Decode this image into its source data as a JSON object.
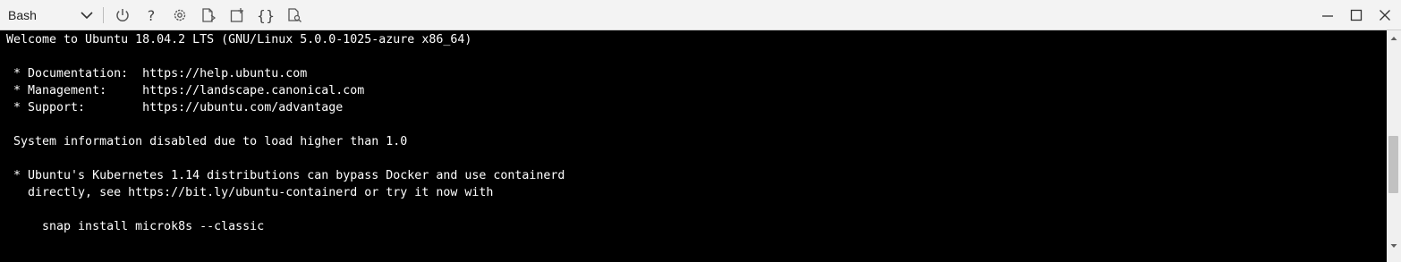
{
  "toolbar": {
    "shell_label": "Bash",
    "help_glyph": "?",
    "braces_glyph": "{}",
    "icons": [
      "restart-icon",
      "help-icon",
      "settings-icon",
      "upload-download-icon",
      "new-session-icon",
      "editor-icon",
      "web-preview-icon"
    ]
  },
  "window": {
    "controls": [
      "minimize-icon",
      "maximize-icon",
      "close-icon"
    ]
  },
  "terminal": {
    "lines": [
      "Welcome to Ubuntu 18.04.2 LTS (GNU/Linux 5.0.0-1025-azure x86_64)",
      "",
      " * Documentation:  https://help.ubuntu.com",
      " * Management:     https://landscape.canonical.com",
      " * Support:        https://ubuntu.com/advantage",
      "",
      " System information disabled due to load higher than 1.0",
      "",
      " * Ubuntu's Kubernetes 1.14 distributions can bypass Docker and use containerd",
      "   directly, see https://bit.ly/ubuntu-containerd or try it now with",
      "",
      "     snap install microk8s --classic"
    ]
  },
  "colors": {
    "toolbar_bg": "#f3f3f3",
    "terminal_bg": "#000000",
    "terminal_fg": "#ffffff",
    "icon": "#555555"
  }
}
